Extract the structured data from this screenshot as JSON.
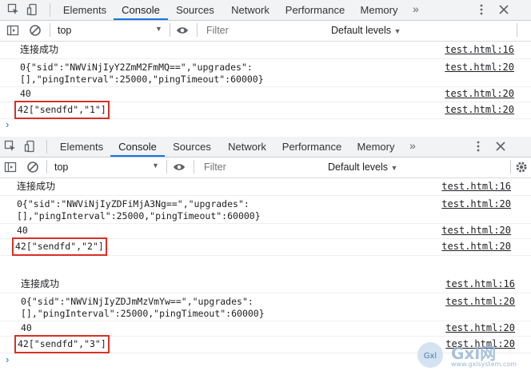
{
  "tabs": [
    "Elements",
    "Console",
    "Sources",
    "Network",
    "Performance",
    "Memory"
  ],
  "active_tab": "Console",
  "more_tabs": "»",
  "context": "top",
  "filter_placeholder": "Filter",
  "levels": "Default levels",
  "panels": [
    {
      "messages": [
        {
          "text": "连接成功",
          "source": "test.html:16"
        },
        {
          "text": "0{\"sid\":\"NWViNjIyY2ZmM2FmMQ==\",\"upgrades\":\n[],\"pingInterval\":25000,\"pingTimeout\":60000}",
          "source": "test.html:20"
        },
        {
          "text": "40",
          "source": "test.html:20"
        },
        {
          "text": "42[\"sendfd\",\"1\"]",
          "source": "test.html:20"
        }
      ]
    },
    {
      "messages": [
        {
          "text": "连接成功",
          "source": "test.html:16"
        },
        {
          "text": "0{\"sid\":\"NWViNjIyZDFiMjA3Ng==\",\"upgrades\":\n[],\"pingInterval\":25000,\"pingTimeout\":60000}",
          "source": "test.html:20"
        },
        {
          "text": "40",
          "source": "test.html:20"
        },
        {
          "text": "42[\"sendfd\",\"2\"]",
          "source": "test.html:20"
        }
      ]
    },
    {
      "messages": [
        {
          "text": "连接成功",
          "source": "test.html:16"
        },
        {
          "text": "0{\"sid\":\"NWViNjIyZDJmMzVmYw==\",\"upgrades\":\n[],\"pingInterval\":25000,\"pingTimeout\":60000}",
          "source": "test.html:20"
        },
        {
          "text": "40",
          "source": "test.html:20"
        },
        {
          "text": "42[\"sendfd\",\"3\"]",
          "source": "test.html:20"
        }
      ]
    }
  ],
  "prompt": "›",
  "watermark": {
    "logo": "Gxl",
    "brand": "Gxl网",
    "url": "www.gxlsystem.com"
  },
  "colors": {
    "accent": "#1a73e8",
    "highlight_box": "#d93025",
    "toolbar_bg": "#f1f3f4"
  }
}
